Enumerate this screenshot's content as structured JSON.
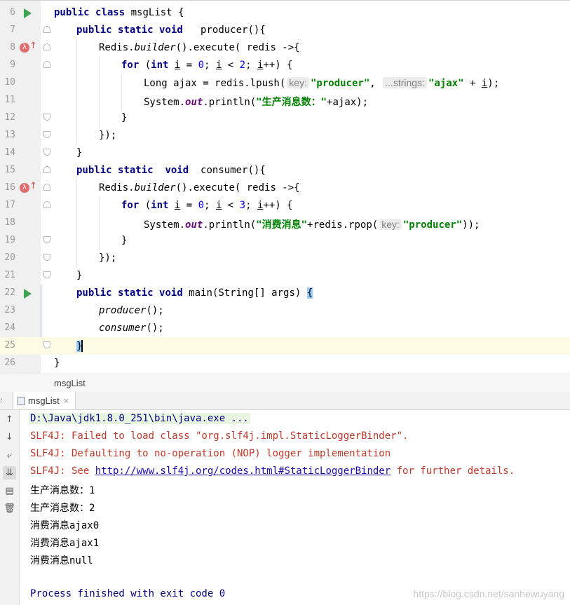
{
  "editor": {
    "lines": [
      {
        "num": "6"
      },
      {
        "num": "7"
      },
      {
        "num": "8"
      },
      {
        "num": "9"
      },
      {
        "num": "10"
      },
      {
        "num": "11"
      },
      {
        "num": "12"
      },
      {
        "num": "13"
      },
      {
        "num": "14"
      },
      {
        "num": "15"
      },
      {
        "num": "16"
      },
      {
        "num": "17"
      },
      {
        "num": "18"
      },
      {
        "num": "19"
      },
      {
        "num": "20"
      },
      {
        "num": "21"
      },
      {
        "num": "22"
      },
      {
        "num": "23"
      },
      {
        "num": "24"
      },
      {
        "num": "25"
      },
      {
        "num": "26"
      }
    ],
    "tokens": {
      "public": "public",
      "class": "class",
      "static": "static",
      "void": "void",
      "for": "for",
      "int": "int",
      "class_name": " msgList {",
      "producer_sig": "   producer(){",
      "consumer_sig": "  consumer(){",
      "main_sig": " main(String[] args) ",
      "redis_builder_a": "Redis.",
      "builder": "builder",
      "redis_builder_b": "().execute( redis ->{",
      "for_open": "(",
      "i": "i",
      "eq": " = ",
      "zero": "0",
      "semi": "; ",
      "lt": " < ",
      "two": "2",
      "three": "3",
      "incr": "++) {",
      "long_ajax": "Long ajax = redis.lpush(",
      "hint_key": "key:",
      "str_producer": "\"producer\"",
      "comma": ",",
      "hint_strings": "...strings:",
      "str_ajax": "\"ajax\"",
      "plus_i": " + ",
      "close_semicolon": ");",
      "system": "System.",
      "out": "out",
      "println_open": ".println(",
      "str_produce_count": "\"生产消息数：\"",
      "plus_ajax": "+ajax);",
      "str_consume": "\"消费消息\"",
      "plus_rpop": "+redis.rpop(",
      "close_rpop": "));",
      "close_brace": "}",
      "close_lambda": "});",
      "open_brace": "{",
      "producer_call": "producer",
      "consumer_call": "consumer",
      "call_end": "();"
    }
  },
  "breadcrumb": {
    "label": "msgList"
  },
  "run_tab": {
    "label": "msgList",
    "close": "×"
  },
  "console": {
    "command": "D:\\Java\\jdk1.8.0_251\\bin\\java.exe ...",
    "slf4j_1": "SLF4J: Failed to load class \"org.slf4j.impl.StaticLoggerBinder\".",
    "slf4j_2": "SLF4J: Defaulting to no-operation (NOP) logger implementation",
    "slf4j_3_prefix": "SLF4J: See ",
    "slf4j_3_link": "http://www.slf4j.org/codes.html#StaticLoggerBinder",
    "slf4j_3_suffix": " for further details.",
    "out_1": "生产消息数：1",
    "out_2": "生产消息数：2",
    "out_3": "消费消息ajax0",
    "out_4": "消费消息ajax1",
    "out_5": "消费消息null",
    "finished": "Process finished with exit code 0"
  },
  "tools": {
    "up": "↑",
    "down": "↓",
    "wrap": "⤶",
    "scroll_end": "⇊",
    "print": "▤",
    "trash": "🗑"
  },
  "watermark": "https://blog.csdn.net/sanhewuyang"
}
